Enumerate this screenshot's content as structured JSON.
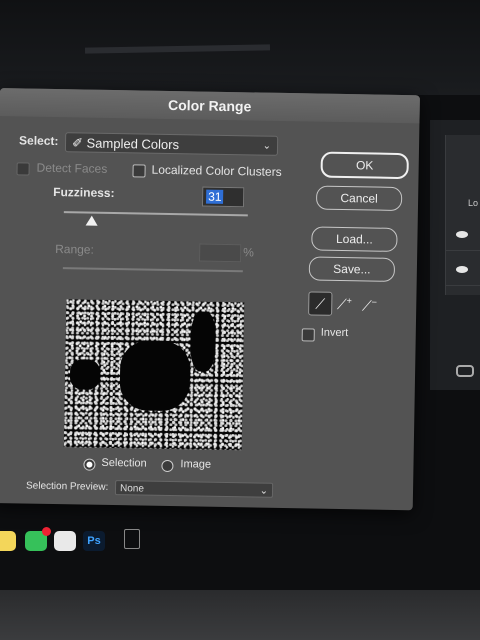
{
  "dialog": {
    "title": "Color Range",
    "select_label": "Select:",
    "select_value": "Sampled Colors",
    "detect_faces": "Detect Faces",
    "localized": "Localized Color Clusters",
    "fuzziness_label": "Fuzziness:",
    "fuzziness_value": "31",
    "range_label": "Range:",
    "range_unit": "%",
    "selection_label": "Selection",
    "image_label": "Image",
    "preview_label": "Selection Preview:",
    "preview_value": "None",
    "invert_label": "Invert",
    "ok": "OK",
    "cancel": "Cancel",
    "load": "Load...",
    "save": "Save..."
  },
  "controls": {
    "fuzziness_slider_fraction": 0.15,
    "view_mode": "Selection",
    "detect_faces_checked": false,
    "localized_checked": false,
    "invert_checked": false
  },
  "icons": {
    "eyedropper": "eyedropper-icon",
    "add_sample": "eyedropper-plus-icon",
    "subtract_sample": "eyedropper-minus-icon"
  },
  "layers_panel": {
    "label": "Lo"
  },
  "dock": {
    "ps_label": "Ps"
  },
  "colors": {
    "dialog_bg": "#535353",
    "highlight": "#2f6fd6"
  }
}
